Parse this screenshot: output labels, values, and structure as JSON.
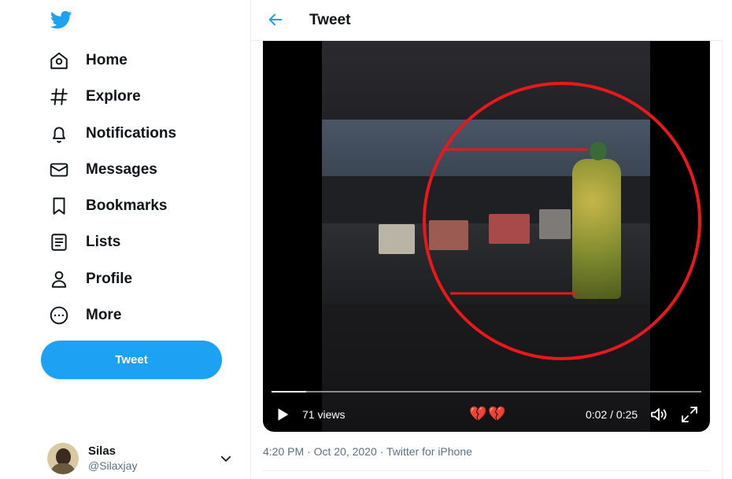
{
  "app": {
    "brand_color": "#1da1f2"
  },
  "sidebar": {
    "logo": "twitter-bird-icon",
    "items": [
      {
        "label": "Home",
        "icon": "home-icon"
      },
      {
        "label": "Explore",
        "icon": "hashtag-icon"
      },
      {
        "label": "Notifications",
        "icon": "bell-icon"
      },
      {
        "label": "Messages",
        "icon": "envelope-icon"
      },
      {
        "label": "Bookmarks",
        "icon": "bookmark-icon"
      },
      {
        "label": "Lists",
        "icon": "list-icon"
      },
      {
        "label": "Profile",
        "icon": "person-icon"
      },
      {
        "label": "More",
        "icon": "more-circle-icon"
      }
    ],
    "tweet_button": "Tweet",
    "account": {
      "name": "Silas",
      "handle": "@Silaxjay"
    }
  },
  "header": {
    "title": "Tweet",
    "back_icon": "arrow-left-icon"
  },
  "video": {
    "views": "71 views",
    "emoji": "💔💔",
    "time": "0:02 / 0:25",
    "progress": 0.08,
    "annotation_color": "#e8181c"
  },
  "tweet_meta": {
    "time": "4:20 PM",
    "date": "Oct 20, 2020",
    "source": "Twitter for iPhone",
    "separator": "·"
  }
}
